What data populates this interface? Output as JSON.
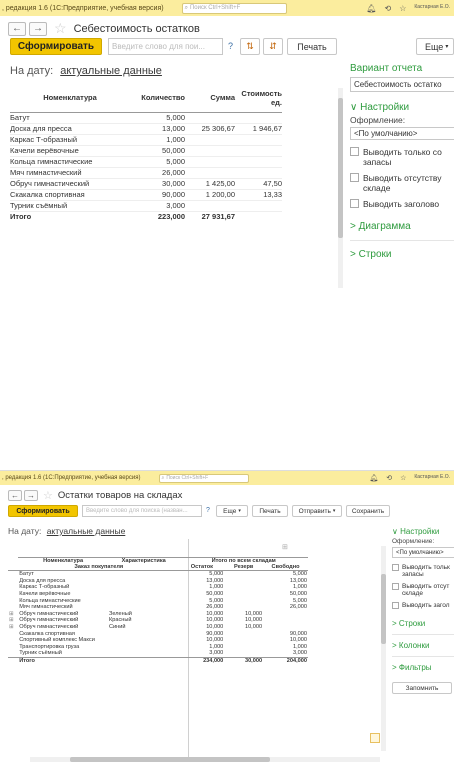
{
  "w1": {
    "titlebar": {
      "title": ", редакция 1.6  (1С:Предприятие, учебная версия)",
      "search_placeholder": "Поиск Ctrl+Shift+F",
      "user": "Кастарная Е.О."
    },
    "form_title": "Себестоимость остатков",
    "toolbar": {
      "generate": "Сформировать",
      "search_placeholder": "Введите слово для пои...",
      "help": "?",
      "print": "Печать",
      "more": "Еще"
    },
    "date_label": "На дату:",
    "date_value": "актуальные данные",
    "table": {
      "headers": [
        "Номенклатура",
        "Количество",
        "Сумма",
        "Стоимость ед."
      ],
      "rows": [
        [
          "Батут",
          "5,000",
          "",
          ""
        ],
        [
          "Доска для пресса",
          "13,000",
          "25 306,67",
          "1 946,67"
        ],
        [
          "Каркас Т-образный",
          "1,000",
          "",
          ""
        ],
        [
          "Качели верёвочные",
          "50,000",
          "",
          ""
        ],
        [
          "Кольца гимнастические",
          "5,000",
          "",
          ""
        ],
        [
          "Мяч гимнастический",
          "26,000",
          "",
          ""
        ],
        [
          "Обруч гимнастический",
          "30,000",
          "1 425,00",
          "47,50"
        ],
        [
          "Скакалка спортивная",
          "90,000",
          "1 200,00",
          "13,33"
        ],
        [
          "Турник съёмный",
          "3,000",
          "",
          ""
        ]
      ],
      "total": [
        "Итого",
        "223,000",
        "27 931,67",
        ""
      ]
    },
    "panel": {
      "variant_title": "Вариант отчета",
      "variant_value": "Себестоимость остатко",
      "settings": "Настройки",
      "format_label": "Оформление:",
      "format_value": "<По умолчанию>",
      "checks": [
        "Выводить только со запасы",
        "Выводить отсутству складе",
        "Выводить заголово"
      ],
      "chart": "Диаграмма",
      "rows": "Строки"
    }
  },
  "w2": {
    "titlebar": {
      "title": ", редакция 1.6  (1С:Предприятие, учебная версия)",
      "search_placeholder": "Поиск Ctrl+Shift+F",
      "user": "Кастарная Е.О."
    },
    "form_title": "Остатки товаров на складах",
    "toolbar": {
      "generate": "Сформировать",
      "search_placeholder": "Введите слово для поиска (назван...",
      "help": "?",
      "more": "Еще",
      "print": "Печать",
      "send": "Отправить",
      "save": "Сохранить"
    },
    "date_label": "На дату:",
    "date_value": "актуальные данные",
    "table": {
      "h1": [
        "Номенклатура",
        "Характеристика",
        "Итого по всем складам"
      ],
      "h2": [
        "Заказ покупателя",
        "Остаток",
        "Резерв",
        "Свободно"
      ],
      "rows": [
        [
          "",
          "Батут",
          "",
          "5,000",
          "",
          "5,000"
        ],
        [
          "",
          "Доска для пресса",
          "",
          "13,000",
          "",
          "13,000"
        ],
        [
          "",
          "Каркас Т-образный",
          "",
          "1,000",
          "",
          "1,000"
        ],
        [
          "",
          "Качели верёвочные",
          "",
          "50,000",
          "",
          "50,000"
        ],
        [
          "",
          "Кольца гимнастические",
          "",
          "5,000",
          "",
          "5,000"
        ],
        [
          "",
          "Мяч гимнастический",
          "",
          "26,000",
          "",
          "26,000"
        ],
        [
          "⊞",
          "Обруч гимнастический",
          "Зеленый",
          "10,000",
          "10,000",
          ""
        ],
        [
          "⊞",
          "Обруч гимнастический",
          "Красный",
          "10,000",
          "10,000",
          ""
        ],
        [
          "⊞",
          "Обруч гимнастический",
          "Синий",
          "10,000",
          "10,000",
          ""
        ],
        [
          "",
          "Скакалка спортивная",
          "",
          "90,000",
          "",
          "90,000"
        ],
        [
          "",
          "Спортивный комплекс Макси",
          "",
          "10,000",
          "",
          "10,000"
        ],
        [
          "",
          "Транспортировка груза",
          "",
          "1,000",
          "",
          "1,000"
        ],
        [
          "",
          "Турник съёмный",
          "",
          "3,000",
          "",
          "3,000"
        ]
      ],
      "total": [
        "",
        "Итого",
        "",
        "234,000",
        "30,000",
        "204,000"
      ]
    },
    "panel": {
      "settings": "Настройки",
      "format_label": "Оформление:",
      "format_value": "<По умолчанию>",
      "checks": [
        "Выводить тольк запасы",
        "Выводить отсут складе",
        "Выводить загол"
      ],
      "rows": "Строки",
      "columns": "Колонки",
      "filters": "Фильтры",
      "remember": "Запомнить"
    }
  }
}
